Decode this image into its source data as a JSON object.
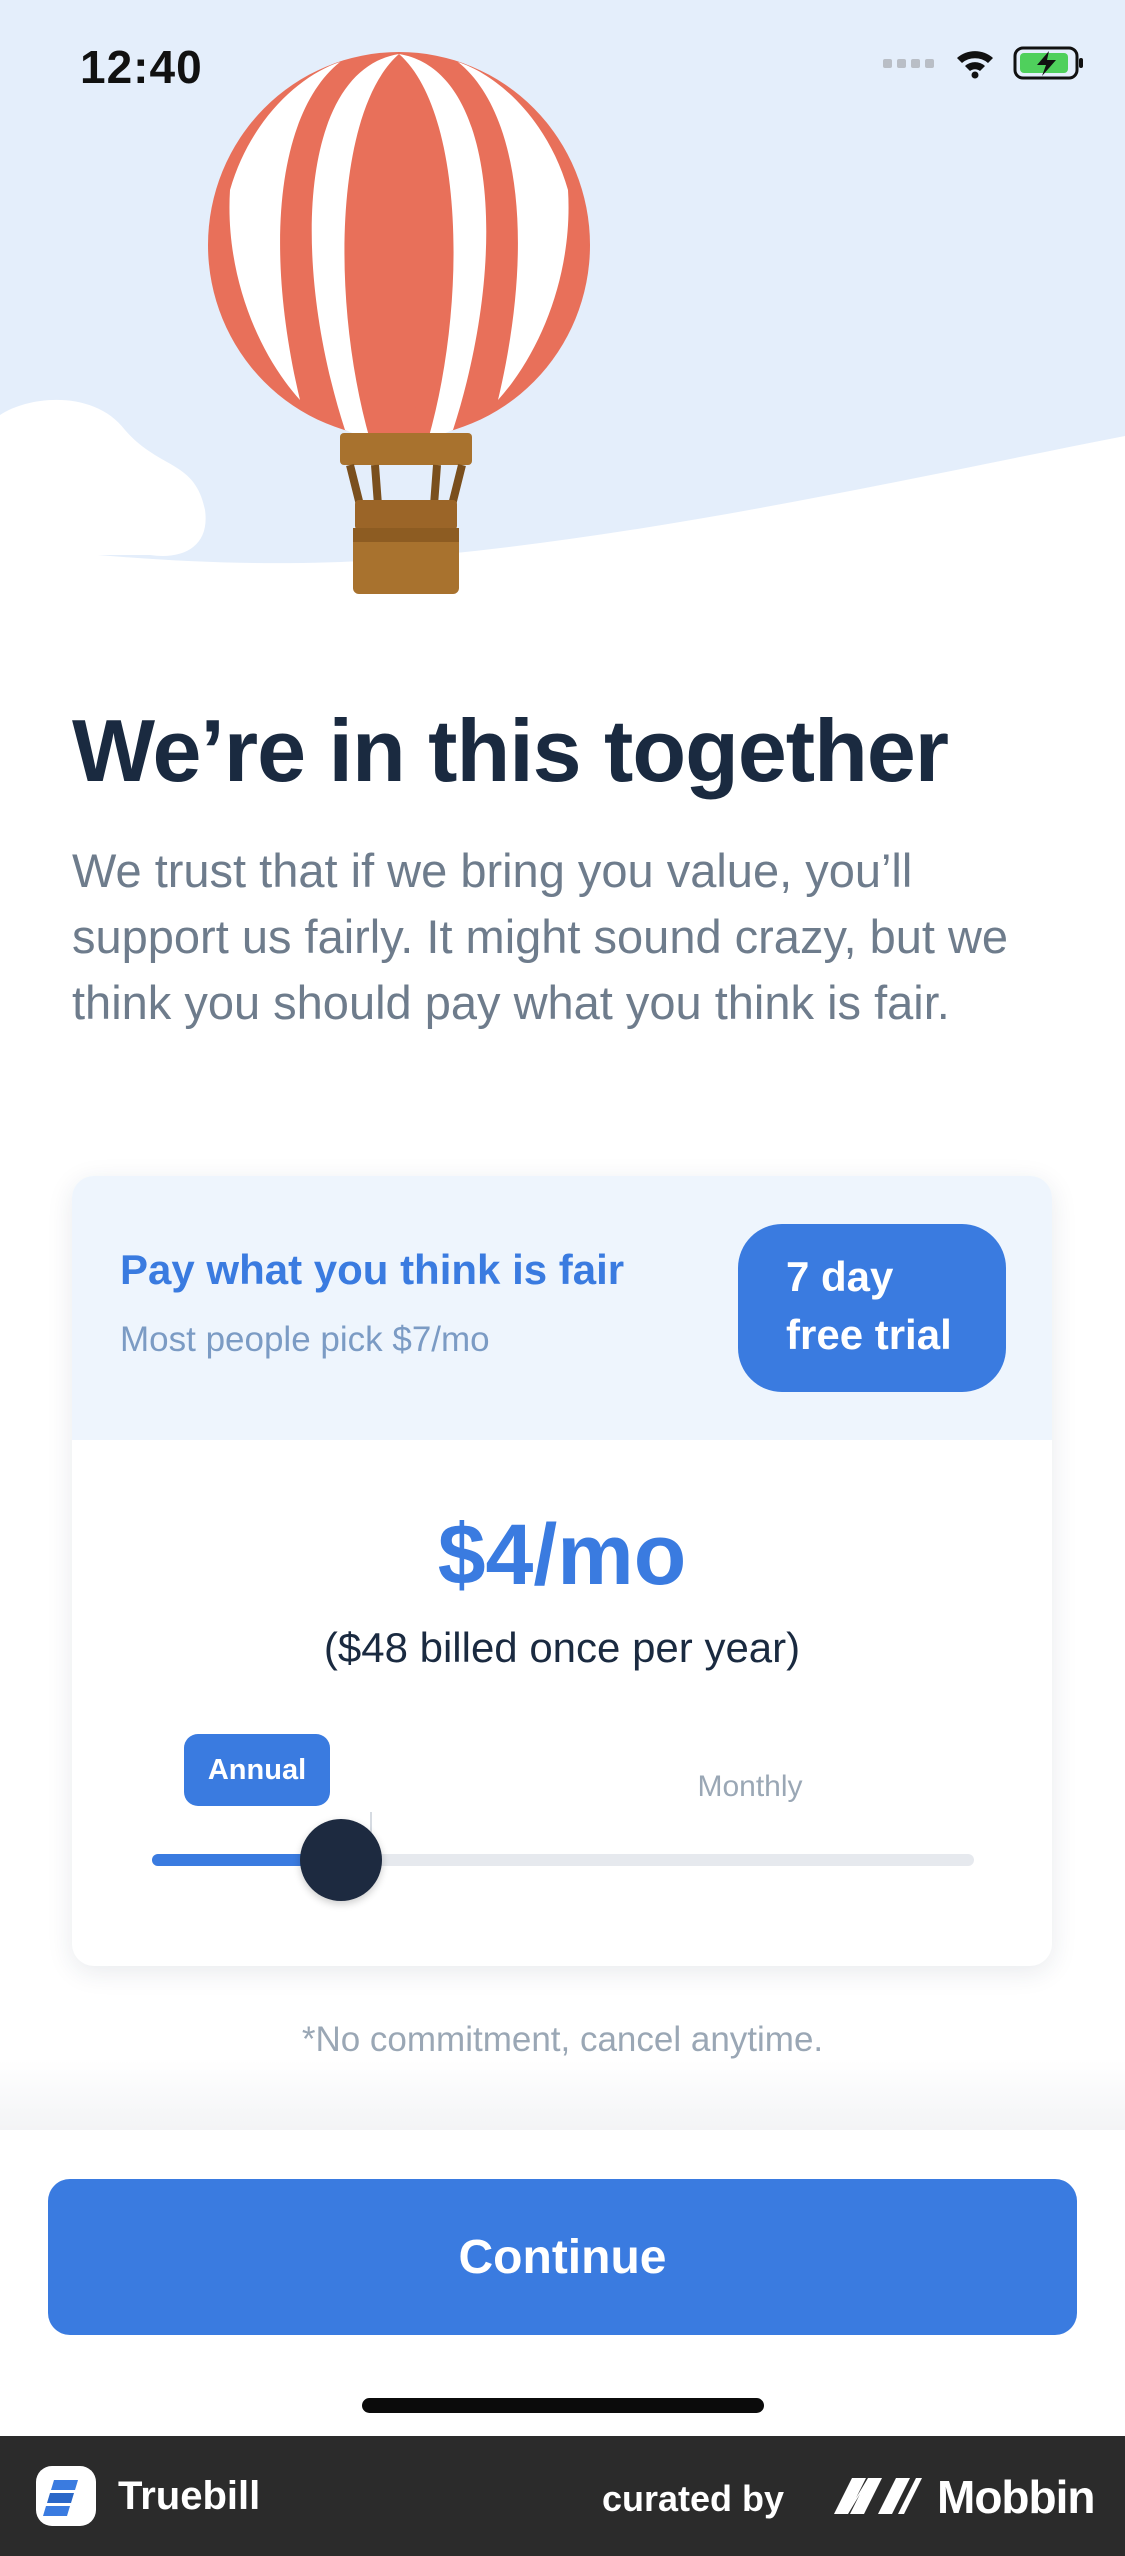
{
  "status_bar": {
    "time": "12:40",
    "icons": [
      "signal-icon",
      "wifi-icon",
      "battery-charging-icon"
    ]
  },
  "hero": {
    "illustration": "hot-air-balloon",
    "colors": {
      "sky": "#e4eefb",
      "balloon_red": "#e8705a",
      "balloon_white": "#ffffff",
      "basket": "#a8722e"
    }
  },
  "headline": "We’re in this together",
  "intro": "We trust that if we bring you value, you’ll support us fairly. It might sound crazy, but we think you should pay what you think is fair.",
  "pricing_card": {
    "title": "Pay what you think is fair",
    "subtitle": "Most people pick $7/mo",
    "trial_badge": {
      "line1": "7 day",
      "line2": "free trial"
    },
    "price": "$4/mo",
    "billing_note": "($48 billed once per year)",
    "options": {
      "annual_label": "Annual",
      "monthly_label": "Monthly",
      "selected": "Annual"
    },
    "slider": {
      "fraction": 0.23
    }
  },
  "disclaimer": "*No commitment, cancel anytime.",
  "cta": {
    "label": "Continue"
  },
  "footer": {
    "app_name": "Truebill",
    "curated_by": "curated by",
    "brand": "Mobbin"
  },
  "colors": {
    "accent": "#3a7be0",
    "heading": "#1a2a40",
    "body_text": "#6e7c8c",
    "muted": "#9aa7b5"
  }
}
